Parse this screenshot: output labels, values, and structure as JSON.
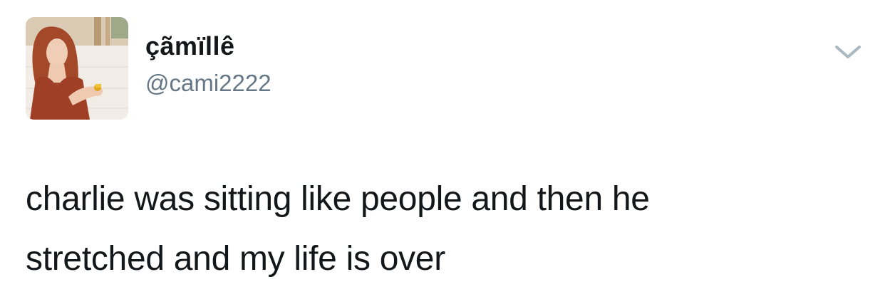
{
  "tweet": {
    "author": {
      "display_name": "çãmïllê",
      "handle": "@cami2222"
    },
    "text_lines": [
      "charlie was sitting like people and then he",
      "stretched and my life is over"
    ]
  },
  "icons": {
    "menu": "chevron-down-icon"
  },
  "colors": {
    "text": "#14171a",
    "secondary": "#657786",
    "chevron": "#aab8c2"
  }
}
